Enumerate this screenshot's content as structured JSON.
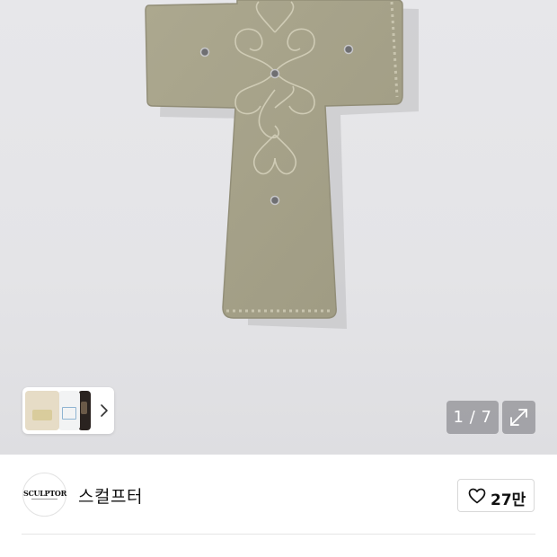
{
  "gallery": {
    "product_image": "suede-cross-keyring-photo",
    "thumbnails": [
      "thumbnail-1",
      "thumbnail-2",
      "thumbnail-3"
    ],
    "thumbnail_next_icon": "chevron-right-icon",
    "counter": "1 / 7",
    "expand_icon": "expand-arrows-icon"
  },
  "seller": {
    "logo_text": "SCULPTOR",
    "name": "스컬프터",
    "like_icon": "heart-outline-icon",
    "like_count": "27만"
  },
  "colors": {
    "image_background": "#e5e5e8",
    "cross_suede": "#a7a38a",
    "overlay_button": "#8c8c91"
  }
}
